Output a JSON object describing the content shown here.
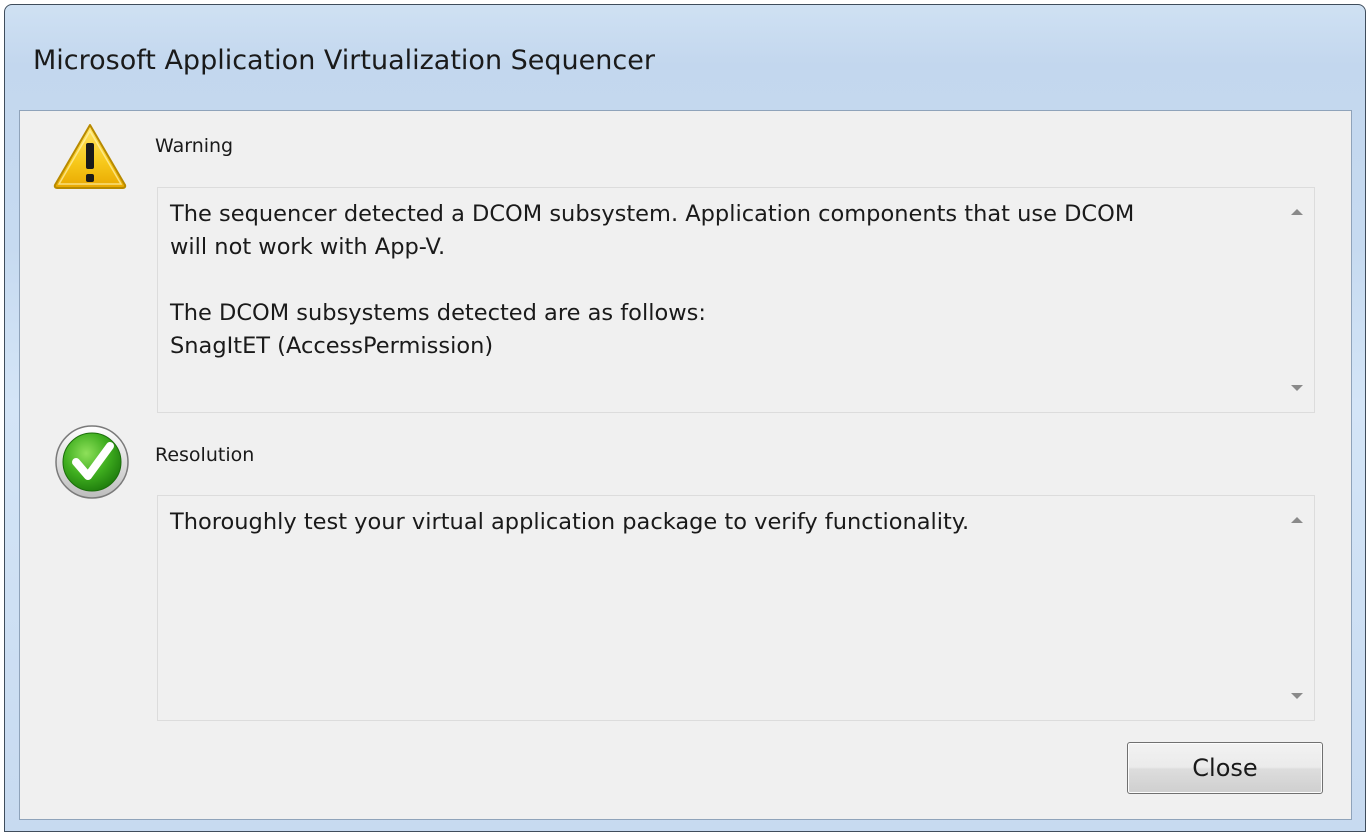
{
  "window": {
    "title": "Microsoft Application Virtualization Sequencer"
  },
  "warning": {
    "label": "Warning",
    "icon": "warning-triangle-icon",
    "message": "The sequencer detected a DCOM subsystem. Application components that use DCOM\nwill not work with App-V.\n\nThe DCOM subsystems detected are as follows:\nSnagItET (AccessPermission)"
  },
  "resolution": {
    "label": "Resolution",
    "icon": "green-checkmark-icon",
    "message": "Thoroughly test your virtual application package to verify functionality."
  },
  "buttons": {
    "close_label": "Close"
  },
  "colors": {
    "frame": "#c6daf0",
    "client": "#f0f0f0",
    "warning_yellow": "#f5c400",
    "check_green": "#39a81e"
  }
}
